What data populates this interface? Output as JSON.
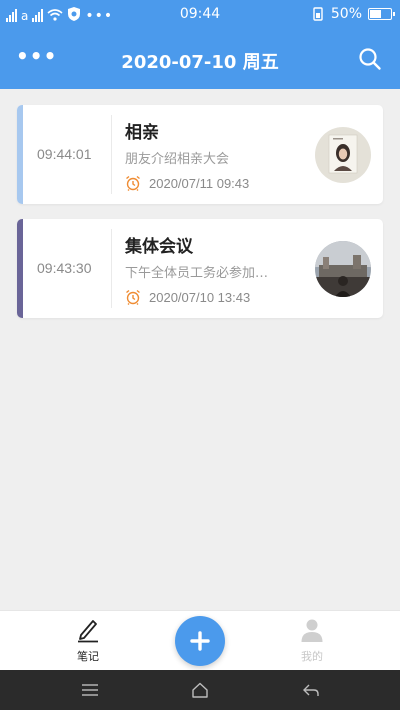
{
  "status_bar": {
    "carrier": "a",
    "time": "09:44",
    "battery": "50%",
    "battery_level": 0.5
  },
  "header": {
    "title": "2020-07-10 周五",
    "icons": [
      "more-icon",
      "search-icon"
    ]
  },
  "notes": [
    {
      "time": "09:44:01",
      "title": "相亲",
      "description": "朋友介绍相亲大会",
      "reminder": "2020/07/11 09:43",
      "stripe_color": "#a7c8ef"
    },
    {
      "time": "09:43:30",
      "title": "集体会议",
      "description": "下午全体员工务必参加…",
      "reminder": "2020/07/10 13:43",
      "stripe_color": "#6a6598"
    }
  ],
  "tabbar": {
    "notes_label": "笔记",
    "mine_label": "我的"
  },
  "colors": {
    "primary": "#4b9aec",
    "background": "#efefef",
    "alarm": "#ef8c33"
  }
}
